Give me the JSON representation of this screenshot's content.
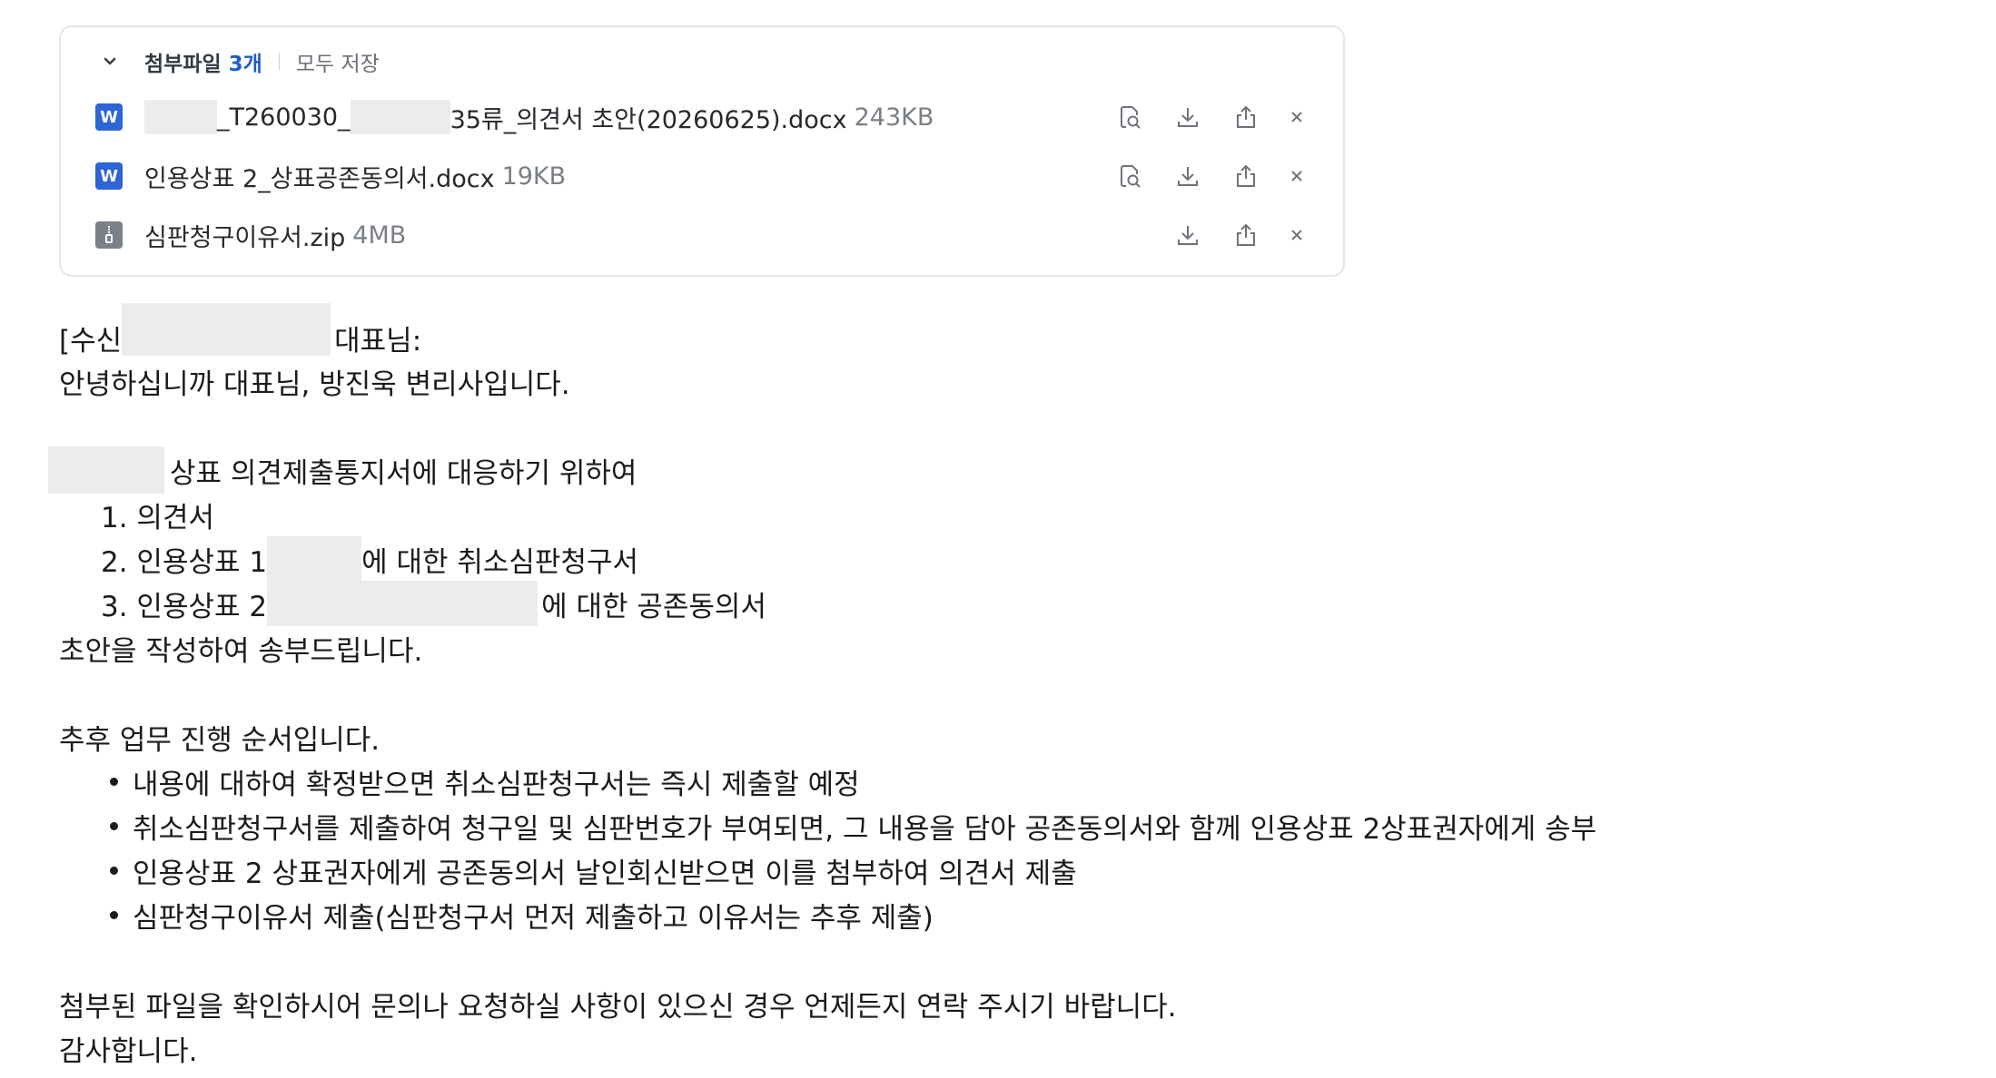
{
  "attachments": {
    "title": "첨부파일",
    "count": "3개",
    "save_all": "모두 저장",
    "files": [
      {
        "icon": "word-icon",
        "icon_letter": "W",
        "name_part1": "_T260030_",
        "name_part2": "35류_의견서 초안(20260625).docx",
        "size": "243KB"
      },
      {
        "icon": "word-icon",
        "icon_letter": "W",
        "name": "인용상표 2_상표공존동의서.docx",
        "size": "19KB"
      },
      {
        "icon": "zip-icon",
        "name": "심판청구이유서.zip",
        "size": "4MB"
      }
    ]
  },
  "message": {
    "greeting_prefix": "[수신",
    "greeting_suffix": "대표님:",
    "intro": "안녕하십니까 대표님, 방진욱 변리사입니다.",
    "purpose": "상표 의견제출통지서에 대응하기 위하여",
    "items": {
      "item1": "1. 의견서",
      "item2_prefix": "2. 인용상표 1",
      "item2_suffix": "에 대한 취소심판청구서",
      "item3_prefix": "3. 인용상표 2",
      "item3_suffix": "에 대한 공존동의서"
    },
    "sent": "초안을 작성하여 송부드립니다.",
    "next_steps_title": "추후 업무 진행 순서입니다.",
    "steps": [
      " 내용에 대하여 확정받으면 취소심판청구서는 즉시 제출할 예정",
      "취소심판청구서를 제출하여 청구일 및 심판번호가 부여되면, 그 내용을 담아 공존동의서와 함께 인용상표 2상표권자에게 송부",
      "인용상표 2 상표권자에게 공존동의서 날인회신받으면 이를 첨부하여 의견서 제출",
      "심판청구이유서 제출(심판청구서 먼저 제출하고 이유서는 추후 제출)"
    ],
    "closing": "첨부된 파일을 확인하시어 문의나 요청하실 사항이 있으신 경우 언제든지 연락 주시기 바랍니다.",
    "thanks": "감사합니다."
  },
  "colors": {
    "accent": "#1f5fc2",
    "word_icon": "#2d64d6",
    "zip_icon": "#7b7f87",
    "redaction": "#ececee"
  }
}
